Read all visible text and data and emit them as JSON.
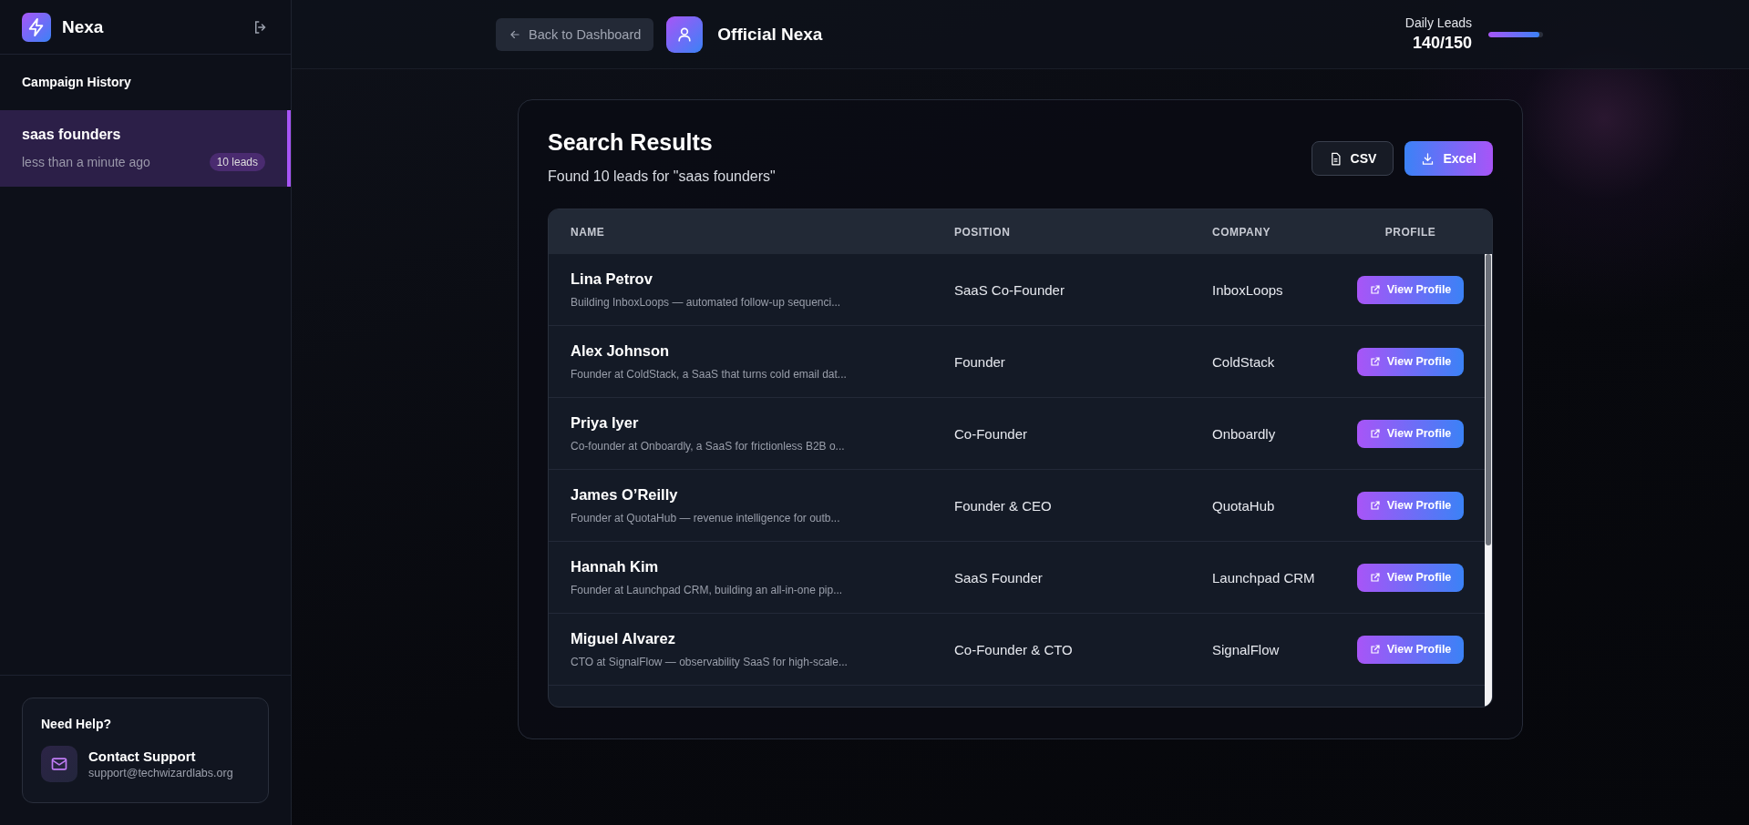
{
  "sidebar": {
    "brand": "Nexa",
    "section_title": "Campaign History",
    "campaigns": [
      {
        "title": "saas founders",
        "time": "less than a minute ago",
        "badge": "10 leads",
        "selected": true
      }
    ],
    "help": {
      "title": "Need Help?",
      "link": "Contact Support",
      "email": "support@techwizardlabs.org"
    }
  },
  "header": {
    "back_button": "Back to Dashboard",
    "account": "Official Nexa",
    "daily_leads": {
      "label": "Daily Leads",
      "value": "140/150",
      "level": 0.93
    }
  },
  "results": {
    "title": "Search Results",
    "subtitle": "Found 10 leads for \"saas founders\"",
    "buttons": [
      {
        "kind": "csv",
        "label": "CSV"
      },
      {
        "kind": "excel",
        "label": "Excel"
      }
    ],
    "table": {
      "columns": [
        "NAME",
        "POSITION",
        "COMPANY",
        "PROFILE"
      ],
      "rows": [
        {
          "name": "Lina Petrov",
          "bio": "Building InboxLoops — automated follow-up sequenci...",
          "position": "SaaS Co-Founder",
          "company": "InboxLoops",
          "action": "View Profile"
        },
        {
          "name": "Alex Johnson",
          "bio": "Founder at ColdStack, a SaaS that turns cold email dat...",
          "position": "Founder",
          "company": "ColdStack",
          "action": "View Profile"
        },
        {
          "name": "Priya Iyer",
          "bio": "Co-founder at Onboardly, a SaaS for frictionless B2B o...",
          "position": "Co-Founder",
          "company": "Onboardly",
          "action": "View Profile"
        },
        {
          "name": "James O’Reilly",
          "bio": "Founder at QuotaHub — revenue intelligence for outb...",
          "position": "Founder & CEO",
          "company": "QuotaHub",
          "action": "View Profile"
        },
        {
          "name": "Hannah Kim",
          "bio": "Founder at Launchpad CRM, building an all-in-one pip...",
          "position": "SaaS Founder",
          "company": "Launchpad CRM",
          "action": "View Profile"
        },
        {
          "name": "Miguel Alvarez",
          "bio": "CTO at SignalFlow — observability SaaS for high-scale...",
          "position": "Co-Founder & CTO",
          "company": "SignalFlow",
          "action": "View Profile"
        }
      ]
    }
  }
}
